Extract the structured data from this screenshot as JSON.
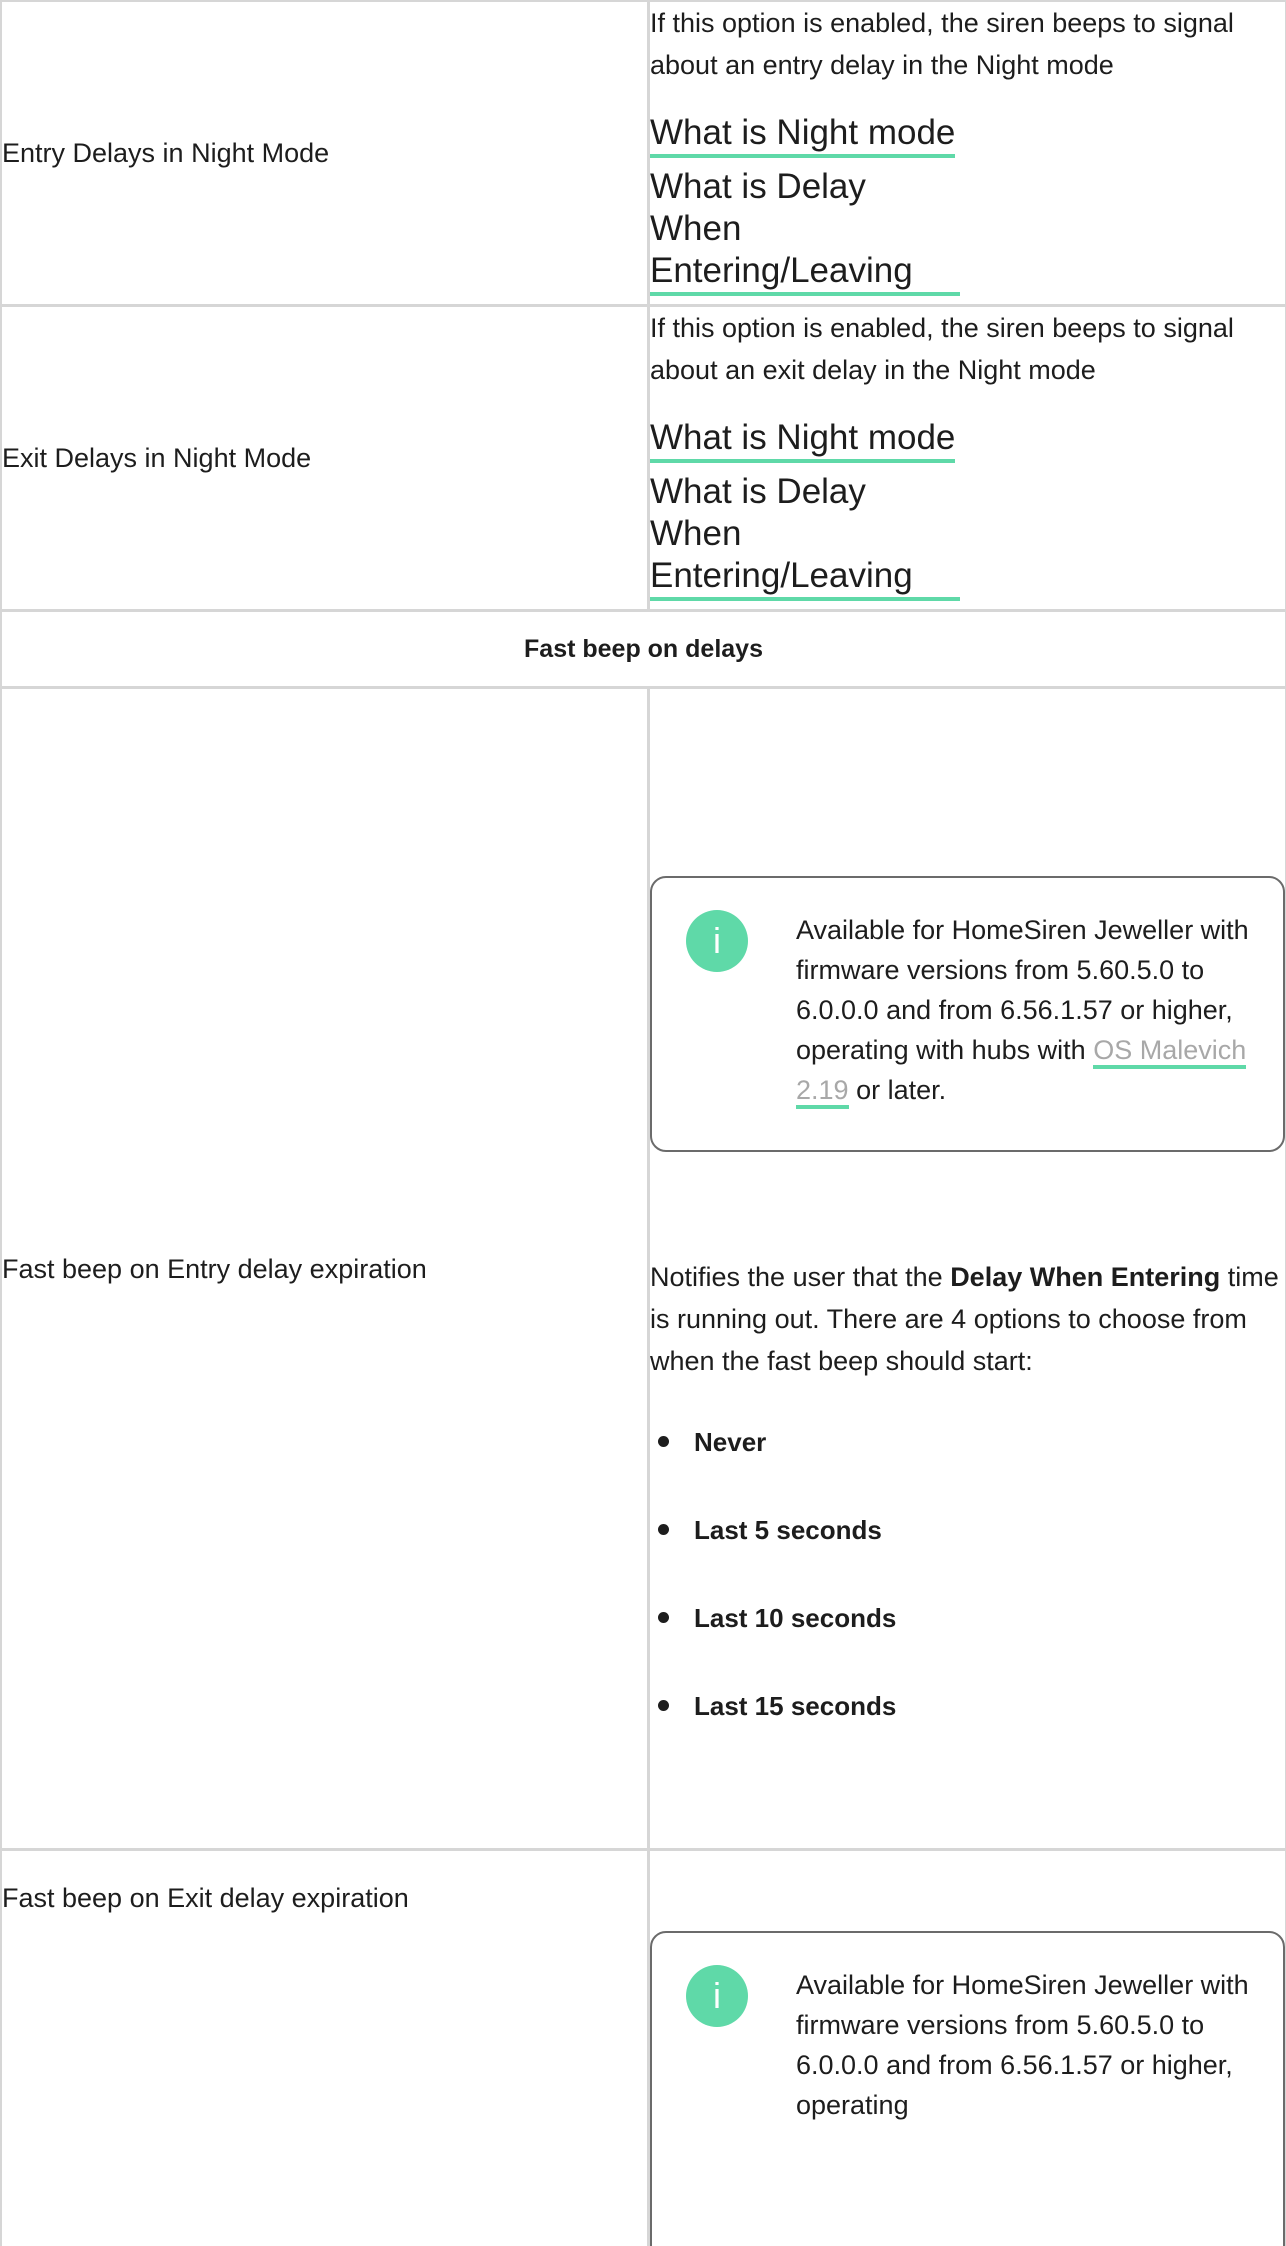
{
  "rows": [
    {
      "label": "Entry Delays in Night Mode",
      "description": "If this option is enabled, the siren beeps to signal about an entry delay in the Night mode",
      "links": [
        "What is Night mode",
        "What is Delay When Entering/Leaving"
      ]
    },
    {
      "label": "Exit Delays in Night Mode",
      "description": "If this option is enabled, the siren beeps to signal about an exit delay in the Night mode",
      "links": [
        "What is Night mode",
        "What is Delay When Entering/Leaving"
      ]
    }
  ],
  "section_header": "Fast beep on delays",
  "fast_entry": {
    "label": "Fast beep on Entry delay expiration",
    "info": {
      "icon": "info-icon",
      "glyph": "i",
      "text_before": "Available for HomeSiren Jeweller with firmware versions from 5.60.5.0 to 6.0.0.0 and from 6.56.1.57 or higher, operating with hubs with",
      "link": "OS Malevich 2.19",
      "text_after": "or later."
    },
    "desc_before": "Notifies the user that the",
    "desc_bold": "Delay When Entering",
    "desc_after": "time is running out. There are 4 options to choose from when the fast beep should start:",
    "options": [
      "Never",
      "Last 5 seconds",
      "Last 10 seconds",
      "Last 15 seconds"
    ]
  },
  "fast_exit": {
    "label": "Fast beep on Exit delay expiration",
    "info": {
      "icon": "info-icon",
      "glyph": "i",
      "text": "Available for HomeSiren Jeweller with firmware versions from 5.60.5.0 to 6.0.0.0 and from 6.56.1.57 or higher, operating"
    }
  },
  "colors": {
    "accent": "#5fd9a8",
    "border": "#d6d6d6",
    "text": "#1d1d1d",
    "muted_link": "#a8a8a8"
  }
}
